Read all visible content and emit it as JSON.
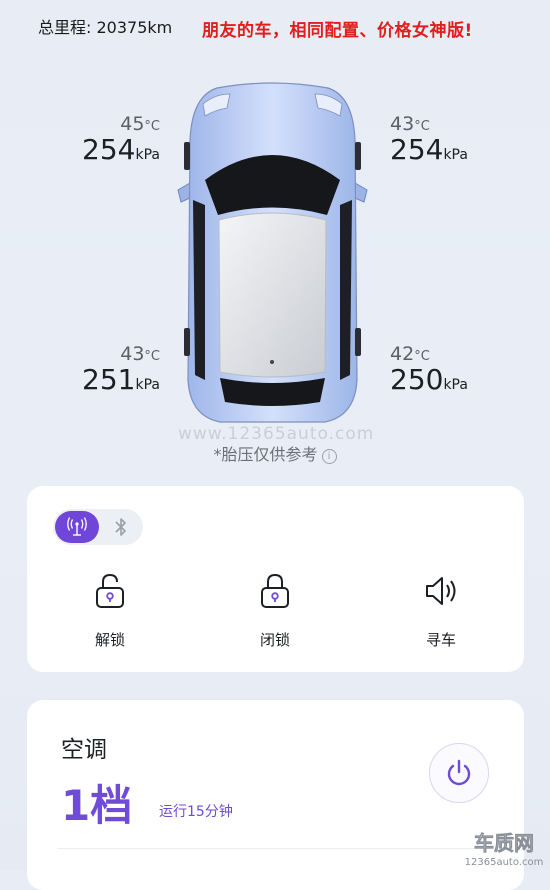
{
  "header": {
    "mileage": "总里程: 20375km",
    "annotation": "朋友的车，相同配置、价格女神版!"
  },
  "tires": {
    "front_left": {
      "temp": "45",
      "temp_unit": "°C",
      "pressure": "254",
      "pressure_unit": "kPa"
    },
    "front_right": {
      "temp": "43",
      "temp_unit": "°C",
      "pressure": "254",
      "pressure_unit": "kPa"
    },
    "rear_left": {
      "temp": "43",
      "temp_unit": "°C",
      "pressure": "251",
      "pressure_unit": "kPa"
    },
    "rear_right": {
      "temp": "42",
      "temp_unit": "°C",
      "pressure": "250",
      "pressure_unit": "kPa"
    }
  },
  "watermark": "www.12365auto.com",
  "disclaimer": "*胎压仅供参考",
  "controls": {
    "toggle": {
      "selected": "network-icon",
      "other": "bluetooth-icon"
    },
    "actions": [
      {
        "label": "解锁",
        "icon": "unlock-icon"
      },
      {
        "label": "闭锁",
        "icon": "lock-icon"
      },
      {
        "label": "寻车",
        "icon": "speaker-icon"
      }
    ]
  },
  "ac": {
    "title": "空调",
    "level": "1档",
    "runtime": "运行15分钟",
    "icon": "power-icon"
  },
  "logo": {
    "text": "车质网",
    "url_text": "12365auto.com"
  },
  "colors": {
    "accent": "#6f4bd8",
    "annotation": "#e01e1e"
  }
}
